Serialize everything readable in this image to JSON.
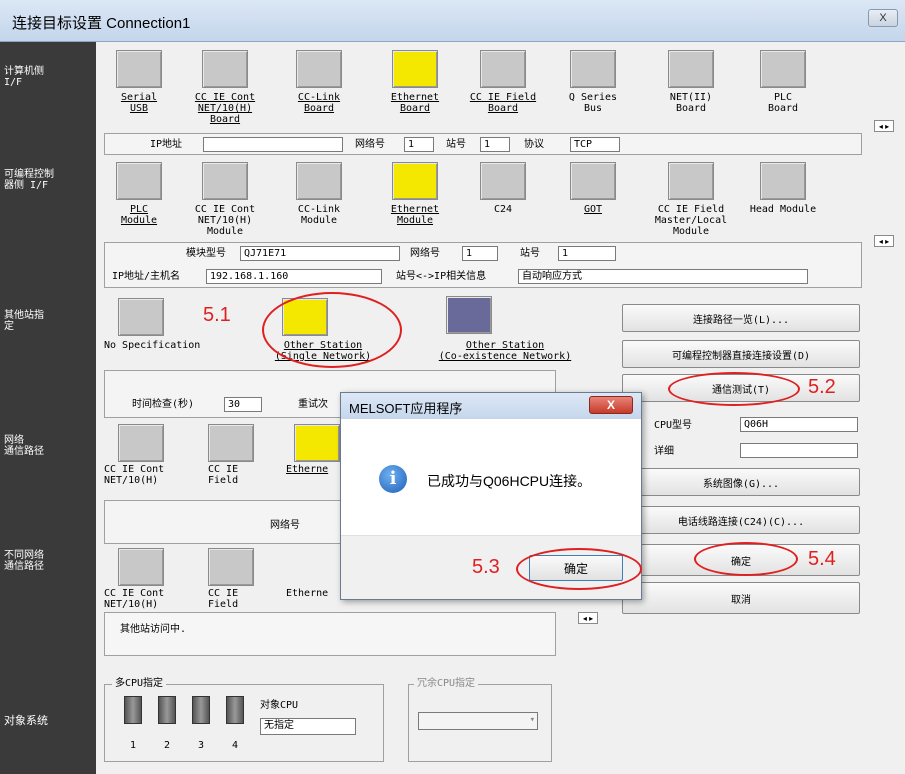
{
  "window": {
    "title": "连接目标设置 Connection1",
    "close": "X"
  },
  "left_labels": {
    "pc": "计算机侧\nI/F",
    "plc": "可编程控制\n器侧 I/F",
    "other": "其他站指\n定",
    "net": "网络\n通信路径",
    "diff": "不同网络\n通信路径",
    "target": "对象系统"
  },
  "pc_if": [
    {
      "label": "Serial\nUSB"
    },
    {
      "label": "CC IE Cont\nNET/10(H)\nBoard"
    },
    {
      "label": "CC-Link\nBoard"
    },
    {
      "label": "Ethernet\nBoard"
    },
    {
      "label": "CC IE Field\nBoard"
    },
    {
      "label": "Q Series\nBus"
    },
    {
      "label": "NET(II)\nBoard"
    },
    {
      "label": "PLC\nBoard"
    }
  ],
  "pc_fields": {
    "ip_label": "IP地址",
    "ip_value": "",
    "net_label": "网络号",
    "net_value": "1",
    "station_label": "站号",
    "station_value": "1",
    "protocol_label": "协议",
    "protocol_value": "TCP"
  },
  "plc_if": [
    {
      "label": "PLC\nModule"
    },
    {
      "label": "CC IE Cont\nNET/10(H)\nModule"
    },
    {
      "label": "CC-Link\nModule"
    },
    {
      "label": "Ethernet\nModule"
    },
    {
      "label": "C24"
    },
    {
      "label": "GOT"
    },
    {
      "label": "CC IE Field\nMaster/Local\nModule"
    },
    {
      "label": "Head Module"
    }
  ],
  "plc_fields": {
    "model_label": "模块型号",
    "model_value": "QJ71E71",
    "net_label": "网络号",
    "net_value": "1",
    "station_label": "站号",
    "station_value": "1",
    "host_label": "IP地址/主机名",
    "host_value": "192.168.1.160",
    "assoc_label": "站号<->IP相关信息",
    "assoc_value": "自动响应方式"
  },
  "other_station": {
    "none": "No Specification",
    "single": "Other Station\n(Single Network)",
    "coexist": "Other Station\n(Co-existence Network)"
  },
  "time_check": {
    "label": "时间检查(秒)",
    "value": "30",
    "retry_label": "重试次"
  },
  "net_route": [
    {
      "label": "CC IE Cont\nNET/10(H)"
    },
    {
      "label": "CC IE\nField"
    },
    {
      "label": "Etherne"
    }
  ],
  "net_no_label": "网络号",
  "diff_route": [
    {
      "label": "CC IE Cont\nNET/10(H)"
    },
    {
      "label": "CC IE\nField"
    },
    {
      "label": "Etherne"
    }
  ],
  "status_text": "其他站访问中.",
  "buttons": {
    "route_list": "连接路径一览(L)...",
    "direct": "可编程控制器直接连接设置(D)",
    "test": "通信测试(T)",
    "system_image": "系统图像(G)...",
    "phone": "电话线路连接(C24)(C)...",
    "ok": "确定",
    "cancel": "取消"
  },
  "cpu_info": {
    "type_label": "CPU型号",
    "type_value": "Q06H",
    "detail_label": "详细",
    "detail_value": ""
  },
  "multi_cpu": {
    "legend": "多CPU指定",
    "target_label": "对象CPU",
    "target_value": "无指定",
    "numbers": [
      "1",
      "2",
      "3",
      "4"
    ]
  },
  "redundant": {
    "legend": "冗余CPU指定"
  },
  "dialog": {
    "title": "MELSOFT应用程序",
    "close": "X",
    "message": "已成功与Q06HCPU连接。",
    "ok": "确定"
  },
  "annotations": {
    "a51": "5.1",
    "a52": "5.2",
    "a53": "5.3",
    "a54": "5.4"
  },
  "colors": {
    "annotation": "#e02020",
    "sidebar": "#3a3a3a"
  }
}
